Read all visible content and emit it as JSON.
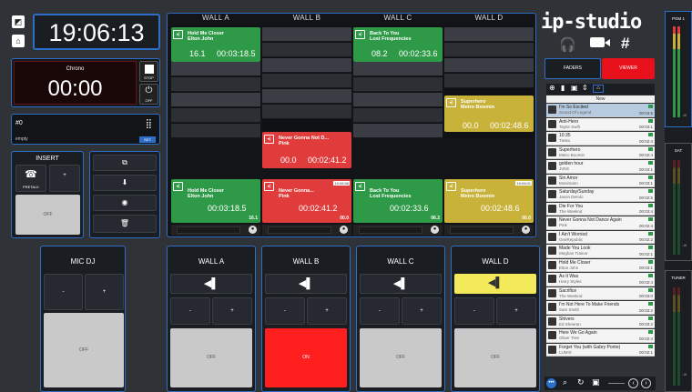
{
  "clock": "19:06:13",
  "chrono": {
    "label": "Chrono",
    "value": "00:00",
    "stop_label": "STOP",
    "off_label": "OFF"
  },
  "cart_box": {
    "number": "#0",
    "status": "empty",
    "set_label": "SET"
  },
  "insert": {
    "title": "INSERT",
    "pretalk_label": "PRETALK",
    "plus": "+",
    "off_label": "OFF"
  },
  "brand": {
    "name": "ip-studio"
  },
  "view_tabs": {
    "faders": "FADERS",
    "viewer": "VIEWER"
  },
  "walls": [
    {
      "name": "WALL A"
    },
    {
      "name": "WALL B"
    },
    {
      "name": "WALL C"
    },
    {
      "name": "WALL D"
    }
  ],
  "wall_carts": {
    "a_top": {
      "title": "Hold Me Closer",
      "artist": "Elton John",
      "num": "16.1",
      "time": "00:03:18.5"
    },
    "c_top": {
      "title": "Back To You",
      "artist": "Lost Frequencies",
      "num": "08.2",
      "time": "00:02:33.6"
    },
    "b_mid": {
      "title": "Never Gonna Not D...",
      "artist": "Pink",
      "num": "00.0",
      "time": "00:02:41.2"
    },
    "d_mid": {
      "title": "Superhero",
      "artist": "Metro Boomin",
      "num": "00.0",
      "time": "00:02:48.6"
    }
  },
  "players": [
    {
      "title": "Hold Me Closer",
      "artist": "Elton John",
      "time": "00:03:18.5",
      "sub": "16.1"
    },
    {
      "title": "Never Gonna...",
      "artist": "Pink",
      "badge": "19:06:56",
      "time": "00:02:41.2",
      "sub": "00.0"
    },
    {
      "title": "Back To You",
      "artist": "Lost Frequencies",
      "time": "00:02:33.6",
      "sub": "06.2"
    },
    {
      "title": "Superhero",
      "artist": "Metro Boomin",
      "badge": "19:09:01",
      "time": "00:02:48.6",
      "sub": "00.0"
    }
  ],
  "mic": {
    "title": "MIC DJ",
    "minus": "-",
    "plus": "+",
    "off_label": "OFF"
  },
  "bottom_walls": [
    {
      "name": "WALL A",
      "minus": "-",
      "plus": "+",
      "state": "OFF"
    },
    {
      "name": "WALL B",
      "minus": "-",
      "plus": "+",
      "state": "ON"
    },
    {
      "name": "WALL C",
      "minus": "-",
      "plus": "+",
      "state": "OFF"
    },
    {
      "name": "WALL D",
      "minus": "-",
      "plus": "+",
      "state": "OFF"
    }
  ],
  "library": {
    "header": "New",
    "items": [
      {
        "title": "I'm So Excited",
        "artist": "Sound Of Legend",
        "dur": "00:03:5"
      },
      {
        "title": "Anti-Hero",
        "artist": "Taylor Swift",
        "dur": "00:03:1"
      },
      {
        "title": "10:35",
        "artist": "Tiesto",
        "dur": "00:02:4"
      },
      {
        "title": "Superhero",
        "artist": "Metro Boomin",
        "dur": "00:02:4"
      },
      {
        "title": "golden hour",
        "artist": "JVKE",
        "dur": "00:03:1"
      },
      {
        "title": "Sin Amor",
        "artist": "Mosimann",
        "dur": "00:03:1"
      },
      {
        "title": "Saturday/Sunday",
        "artist": "Jason Derulo",
        "dur": "00:02:5"
      },
      {
        "title": "Die For You",
        "artist": "The Weeknd",
        "dur": "00:03:4"
      },
      {
        "title": "Never Gonna Not Dance Again",
        "artist": "Pink",
        "dur": "00:02:4"
      },
      {
        "title": "I Ain't Worried",
        "artist": "OneRepublic",
        "dur": "00:02:2"
      },
      {
        "title": "Made You Look",
        "artist": "Meghan Trainor",
        "dur": "00:02:1"
      },
      {
        "title": "Hold Me Closer",
        "artist": "Elton John",
        "dur": "00:03:1"
      },
      {
        "title": "As It Was",
        "artist": "Harry Styles",
        "dur": "00:02:4"
      },
      {
        "title": "Sacrifice",
        "artist": "The Weeknd",
        "dur": "00:03:0"
      },
      {
        "title": "I'm Not Here To Make Friends",
        "artist": "Sam Smith",
        "dur": "00:03:2"
      },
      {
        "title": "Shivers",
        "artist": "Ed Sheeran",
        "dur": "00:03:2"
      },
      {
        "title": "Here We Go Again",
        "artist": "Oliver Tree",
        "dur": "00:02:4"
      },
      {
        "title": "Forget You (with Gabry Ponte)",
        "artist": "LUM!X",
        "dur": "00:02:1"
      }
    ]
  },
  "meters": [
    {
      "label": "PGM 1",
      "scale": "-18"
    },
    {
      "label": "SAT",
      "scale": "-18"
    },
    {
      "label": "TUNER",
      "scale": "-18"
    }
  ],
  "colors": {
    "accent_blue": "#2d6fc8",
    "green": "#2e9a48",
    "red": "#e03c3c",
    "yellow": "#c8b23a",
    "on_red": "#ff1f1f",
    "viewer_red": "#e8101a"
  }
}
